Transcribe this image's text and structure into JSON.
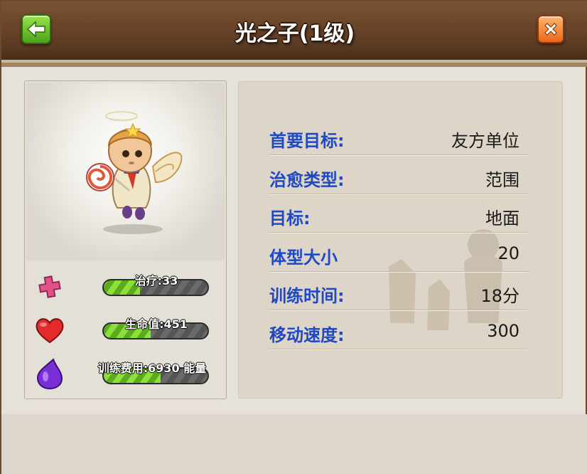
{
  "header": {
    "title": "光之子(1级)"
  },
  "unit": {
    "stats": [
      {
        "icon": "heal-cross-icon",
        "text": "治疗:33",
        "fill_percent": 35
      },
      {
        "icon": "heart-icon",
        "text": "生命值:451",
        "fill_percent": 45
      },
      {
        "icon": "elixir-drop-icon",
        "text": "训练费用:6930 能量",
        "fill_percent": 55
      }
    ]
  },
  "info": {
    "rows": [
      {
        "label": "首要目标:",
        "value": "友方单位"
      },
      {
        "label": "治愈类型:",
        "value": "范围"
      },
      {
        "label": "目标:",
        "value": "地面"
      },
      {
        "label": "体型大小",
        "value": "20"
      },
      {
        "label": "训练时间:",
        "value": "18分"
      },
      {
        "label": "移动速度:",
        "value": "300"
      }
    ]
  },
  "colors": {
    "header_brown": "#5e3c24",
    "label_blue": "#1f49c4",
    "bar_green": "#8be03c",
    "back_green": "#4aa41a",
    "close_orange": "#e8681c"
  }
}
